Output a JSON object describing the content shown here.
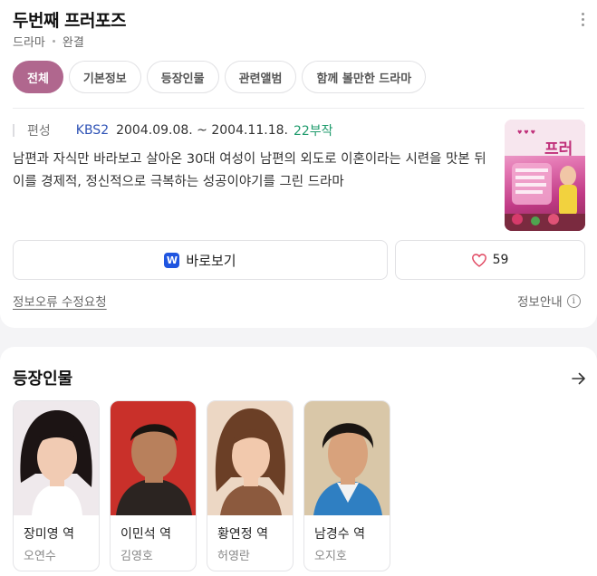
{
  "header": {
    "title": "두번째 프러포즈",
    "genre": "드라마",
    "status": "완결"
  },
  "tabs": [
    {
      "label": "전체",
      "active": true
    },
    {
      "label": "기본정보",
      "active": false
    },
    {
      "label": "등장인물",
      "active": false
    },
    {
      "label": "관련앨범",
      "active": false
    },
    {
      "label": "함께 볼만한 드라마",
      "active": false
    }
  ],
  "info": {
    "label": "편성",
    "network": "KBS2",
    "period": "2004.09.08. ~ 2004.11.18.",
    "episodes": "22부작",
    "description": "남편과 자식만 바라보고 살아온 30대 여성이 남편의 외도로 이혼이라는 시련을 맛본 뒤 이를 경제적, 정신적으로 극복하는 성공이야기를 그린 드라마"
  },
  "poster": {
    "title_text": "두번째 프러포즈"
  },
  "actions": {
    "watch_icon": "W",
    "watch_label": "바로보기",
    "like_count": "59"
  },
  "footer": {
    "report_label": "정보오류 수정요청",
    "guide_label": "정보안내",
    "guide_icon": "i"
  },
  "cast": {
    "title": "등장인물",
    "members": [
      {
        "role": "장미영 역",
        "actor": "오연수"
      },
      {
        "role": "이민석 역",
        "actor": "김영호"
      },
      {
        "role": "황연정 역",
        "actor": "허영란"
      },
      {
        "role": "남경수 역",
        "actor": "오지호"
      }
    ]
  },
  "colors": {
    "accent": "#b0678e",
    "network": "#2f53b6",
    "episodes": "#1f9b6c",
    "watch_icon_bg": "#1f55e0",
    "heart": "#e0455f"
  }
}
